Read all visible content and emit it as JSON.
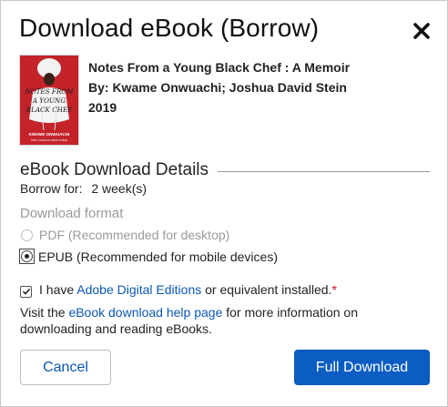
{
  "dialog": {
    "title": "Download eBook (Borrow)",
    "close_icon": "close-icon"
  },
  "book": {
    "title": "Notes From a Young Black Chef : A Memoir",
    "authors": "By: Kwame Onwuachi; Joshua David Stein",
    "year": "2019",
    "cover_title_lines": [
      "NOTES FROM",
      "A YOUNG",
      "BLACK CHEF"
    ],
    "cover_author": "KWAME ONWUACHI",
    "cover_subtitle": "WITH JOSHUA DAVID STEIN",
    "cover_color": "#c4232a"
  },
  "details": {
    "heading": "eBook Download Details",
    "borrow_label": "Borrow for:",
    "borrow_value": "2 week(s)"
  },
  "format": {
    "heading": "Download format",
    "options": [
      {
        "label": "PDF (Recommended for desktop)",
        "selected": false,
        "disabled": true
      },
      {
        "label": "EPUB (Recommended for mobile devices)",
        "selected": true,
        "disabled": false
      }
    ]
  },
  "agreement": {
    "prefix": "I have ",
    "link": "Adobe Digital Editions",
    "suffix": " or equivalent installed.",
    "required_mark": "*",
    "checked": true
  },
  "help": {
    "prefix": "Visit the ",
    "link": "eBook download help page",
    "suffix": " for more information on downloading and reading eBooks."
  },
  "buttons": {
    "cancel": "Cancel",
    "download": "Full Download"
  },
  "colors": {
    "accent": "#0b5dc4",
    "link": "#0b58b5",
    "required": "#d0021b"
  }
}
